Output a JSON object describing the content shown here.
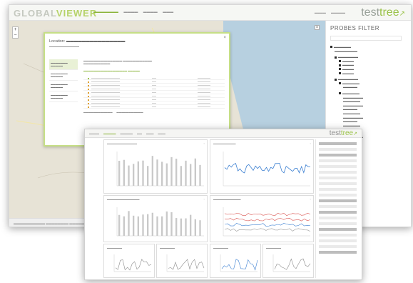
{
  "app": {
    "logo_left": "GLOBAL",
    "logo_right": "VIEWER",
    "brand_left": "test",
    "brand_right": "tree",
    "brand_mark": "↗"
  },
  "map": {
    "zoom_in": "+",
    "zoom_out": "−",
    "close": "×"
  },
  "popup": {
    "location_label": "Location:",
    "close": "×"
  },
  "probes": {
    "title": "PROBES FILTER"
  },
  "front": {
    "brand_left": "test",
    "brand_right": "tree",
    "brand_mark": "↗"
  },
  "colors": {
    "accent_green": "#9bc34a",
    "popup_border": "#c6df86",
    "series_blue": "#3b7fd1",
    "series_red": "#d9534f",
    "map_land": "#e7e3d6",
    "map_water": "#b7d0e0"
  }
}
